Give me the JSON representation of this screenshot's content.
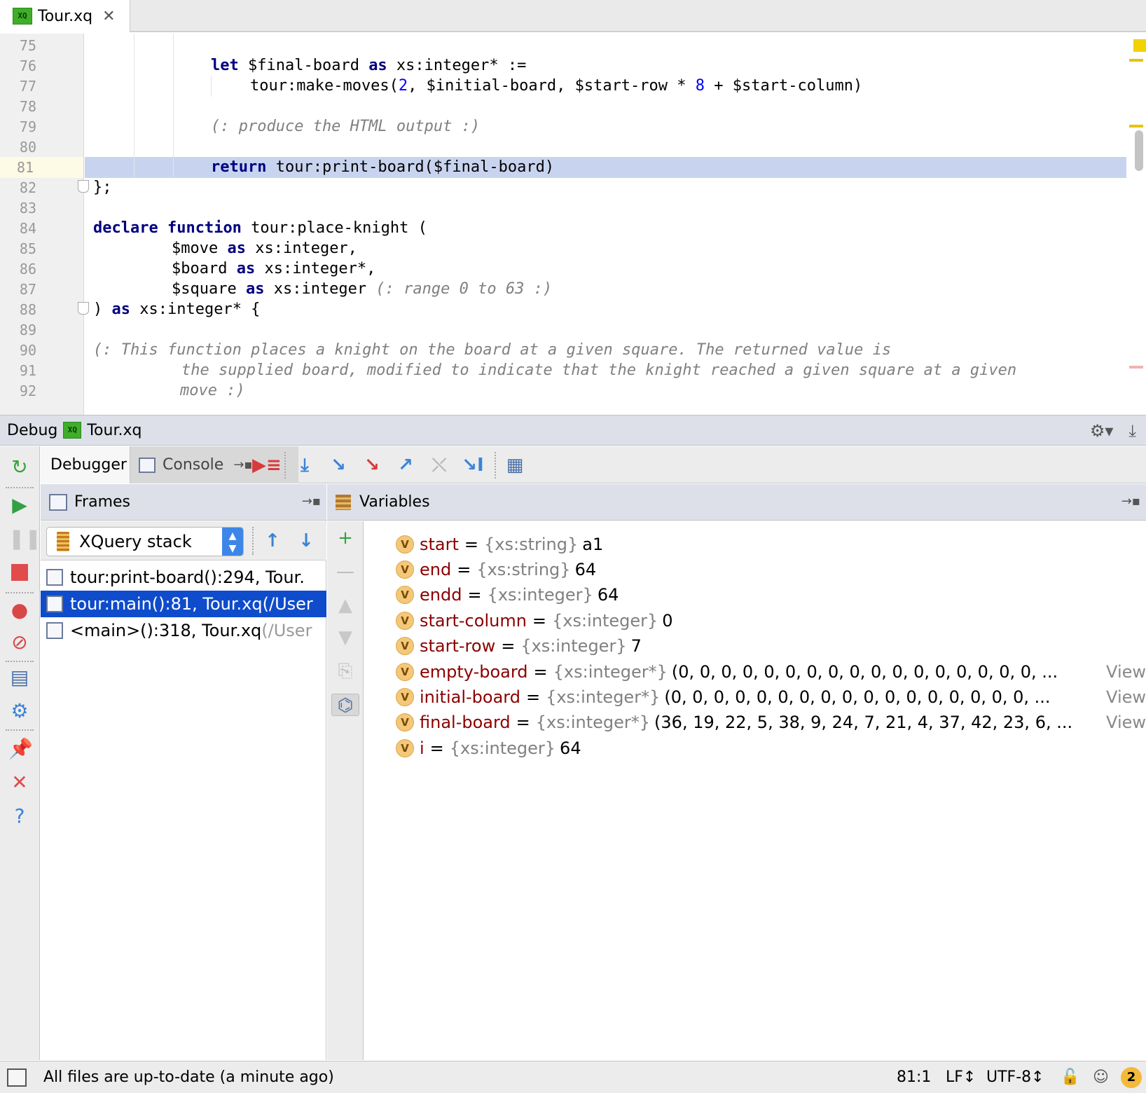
{
  "editor_tab": {
    "badge": "XQ",
    "label": "Tour.xq",
    "close": "✕"
  },
  "gutter": {
    "line_numbers": [
      "75",
      "76",
      "77",
      "78",
      "79",
      "80",
      "81",
      "82",
      "83",
      "84",
      "85",
      "86",
      "87",
      "88",
      "89",
      "90",
      "91",
      "92"
    ],
    "current_line": "81"
  },
  "code": {
    "l76": {
      "kw1": "let",
      "t1": " $final-board ",
      "kw2": "as",
      "t2": " xs:integer* :="
    },
    "l77": {
      "t1": "tour:make-moves(",
      "n1": "2",
      "t2": ", $initial-board, $start-row * ",
      "n2": "8",
      "t3": " + $start-column)"
    },
    "l79": {
      "comment": "(: produce the HTML output :)"
    },
    "l81": {
      "kw1": "return",
      "t1": " tour:print-board($final-board)"
    },
    "l82": {
      "t1": "};"
    },
    "l84": {
      "kw1": "declare",
      "kw2": "function",
      "t1": " tour:place-knight ("
    },
    "l85": {
      "t1": "$move ",
      "kw1": "as",
      "t2": " xs:integer,"
    },
    "l86": {
      "t1": "$board ",
      "kw1": "as",
      "t2": " xs:integer*,"
    },
    "l87": {
      "t1": "$square ",
      "kw1": "as",
      "t2": " xs:integer ",
      "comment": "(: range 0 to 63 :)"
    },
    "l88": {
      "t1": ") ",
      "kw1": "as",
      "t2": " xs:integer* {"
    },
    "l90": {
      "comment": "(: This function places a knight on the board at a given square. The returned value is"
    },
    "l91": {
      "comment": "the supplied board, modified to indicate that the knight reached a given square at a given"
    },
    "l92": {
      "comment": "move :)"
    }
  },
  "debug_header": {
    "title": "Debug",
    "badge": "XQ",
    "file": "Tour.xq",
    "settings_icon": "gear-icon",
    "hide_icon": "hide-panel-icon"
  },
  "debugger_tabs": {
    "debugger": "Debugger",
    "console": "Console"
  },
  "frames": {
    "header": "Frames",
    "stack_select": "XQuery stack",
    "rows": [
      {
        "main": "tour:print-board():294, Tour.",
        "dim": ""
      },
      {
        "main": "tour:main():81, Tour.xq(/User",
        "dim": ""
      },
      {
        "main": "<main>():318, Tour.xq",
        "dim": "(/User"
      }
    ],
    "selected_index": 1
  },
  "variables": {
    "header": "Variables",
    "badge": "V",
    "view_label": "View",
    "rows": [
      {
        "name": "start",
        "type": "{xs:string}",
        "value": "a1",
        "view": ""
      },
      {
        "name": "end",
        "type": "{xs:string}",
        "value": "64",
        "view": ""
      },
      {
        "name": "endd",
        "type": "{xs:integer}",
        "value": "64",
        "view": ""
      },
      {
        "name": "start-column",
        "type": "{xs:integer}",
        "value": "0",
        "view": ""
      },
      {
        "name": "start-row",
        "type": "{xs:integer}",
        "value": "7",
        "view": ""
      },
      {
        "name": "empty-board",
        "type": "{xs:integer*}",
        "value": "(0, 0, 0, 0, 0, 0, 0, 0, 0, 0, 0, 0, 0, 0, 0, 0, 0, ...",
        "view": "View"
      },
      {
        "name": "initial-board",
        "type": "{xs:integer*}",
        "value": "(0, 0, 0, 0, 0, 0, 0, 0, 0, 0, 0, 0, 0, 0, 0, 0, 0, ...",
        "view": "View"
      },
      {
        "name": "final-board",
        "type": "{xs:integer*}",
        "value": "(36, 19, 22, 5, 38, 9, 24, 7, 21, 4, 37, 42, 23, 6, ...",
        "view": "View"
      },
      {
        "name": "i",
        "type": "{xs:integer}",
        "value": "64",
        "view": ""
      }
    ]
  },
  "status_bar": {
    "message": "All files are up-to-date (a minute ago)",
    "position": "81:1",
    "line_ending": "LF↕",
    "encoding": "UTF-8↕",
    "notifications": "2"
  },
  "colors": {
    "selection": "#0f4ccc",
    "highlight_line": "#c8d4ef",
    "keyword": "#00007f",
    "number": "#0000ff",
    "comment": "#808080",
    "var_name": "#8b0000"
  }
}
